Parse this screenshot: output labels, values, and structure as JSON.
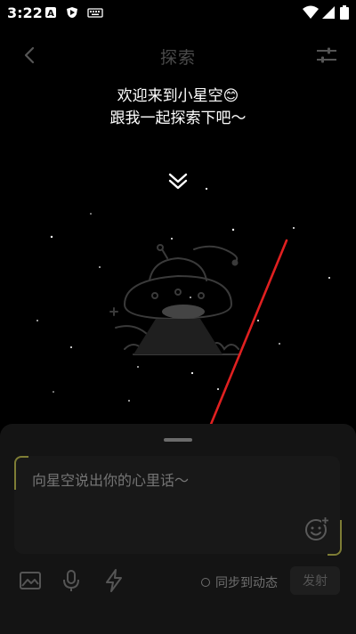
{
  "status_bar": {
    "time": "3:22",
    "icons": [
      "notification-a-icon",
      "shield-play-icon",
      "keyboard-icon",
      "wifi-icon",
      "signal-icon",
      "battery-icon"
    ]
  },
  "header": {
    "title": "探索",
    "back_icon": "chevron-left-icon",
    "filter_icon": "sliders-icon"
  },
  "welcome": {
    "line1": "欢迎来到小星空😊",
    "line2": "跟我一起探索下吧～"
  },
  "bottom_sheet": {
    "input_placeholder": "向星空说出你的心里话～",
    "sync_label": "同步到动态",
    "send_label": "发射",
    "tools": [
      "image-icon",
      "microphone-icon",
      "lightning-icon"
    ],
    "emoji_icon": "emoji-add-icon"
  },
  "colors": {
    "background": "#000000",
    "sheet": "#141414",
    "accent_corner": "#7e7d35",
    "arrow": "#e02020"
  }
}
